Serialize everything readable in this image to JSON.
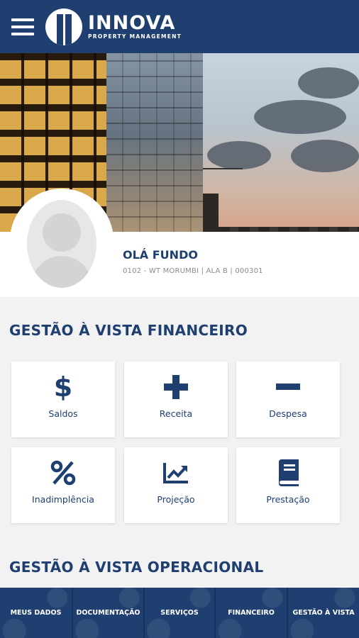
{
  "header": {
    "brand_name": "INNOVA",
    "brand_sub": "PROPERTY MANAGEMENT",
    "menu_icon": "hamburger-menu-icon",
    "color": "#1e3f6f"
  },
  "profile": {
    "greeting": "OLÁ FUNDO",
    "info": "0102 - WT MORUMBI | ALA B | 000301"
  },
  "financial": {
    "title": "GESTÃO À VISTA FINANCEIRO",
    "items": [
      {
        "label": "Saldos",
        "icon": "dollar-icon"
      },
      {
        "label": "Receita",
        "icon": "plus-icon"
      },
      {
        "label": "Despesa",
        "icon": "minus-icon"
      },
      {
        "label": "Inadimplência",
        "icon": "percent-icon"
      },
      {
        "label": "Projeção",
        "icon": "line-chart-icon"
      },
      {
        "label": "Prestação",
        "icon": "book-icon"
      }
    ]
  },
  "operational": {
    "title": "GESTÃO À VISTA OPERACIONAL"
  },
  "bottom_nav": {
    "items": [
      {
        "label": "MEUS DADOS"
      },
      {
        "label": "DOCUMENTAÇÃO"
      },
      {
        "label": "SERVIÇOS"
      },
      {
        "label": "FINANCEIRO"
      },
      {
        "label": "GESTÃO À VISTA"
      }
    ]
  },
  "colors": {
    "primary": "#1e3f6f",
    "background": "#f2f2f2",
    "secondary_text": "#8a8a8a"
  }
}
